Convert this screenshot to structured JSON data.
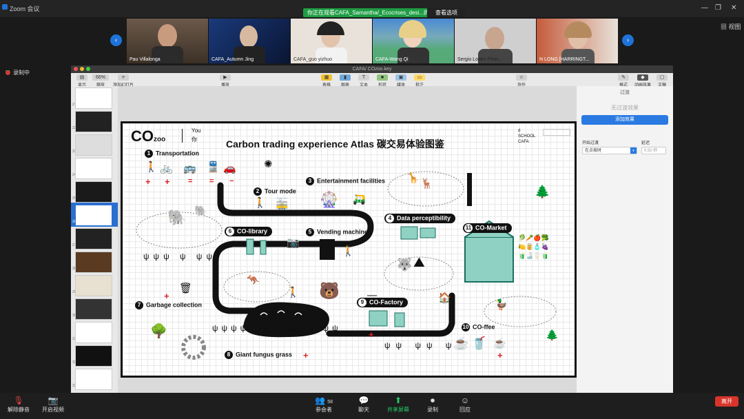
{
  "zoom": {
    "window_title": "Zoom 会议",
    "view_label": "视图",
    "recording_label": "录制中"
  },
  "banner": {
    "text": "你正在观看CAFA_Samantha/_Ecocrises_desi...的屏幕",
    "button": "查看选项"
  },
  "participants": [
    {
      "name": "Pau Villalonga"
    },
    {
      "name": "CAFA_Autumn Jing"
    },
    {
      "name": "CAFA_guo yizhuo"
    },
    {
      "name": "CAFA-Wang Qi"
    },
    {
      "name": "Sergio Lopez-Pinei..."
    },
    {
      "name": "N LONG [HARRINGT..."
    }
  ],
  "keynote": {
    "file_title": "CAFA/ COzoo.key",
    "toolbar": {
      "view": "显示",
      "zoom": "66%",
      "zoom_label": "缩放",
      "add_slide": "添加幻灯片",
      "play": "播放",
      "table": "表格",
      "chart": "图表",
      "text": "文本",
      "shape": "形状",
      "media": "媒体",
      "comment": "批注",
      "collaborate": "协作",
      "format": "格式",
      "animate": "动画效果",
      "document": "文稿"
    },
    "thumb_numbers": [
      "21",
      "22",
      "23",
      "24",
      "25",
      "26",
      "27",
      "28",
      "29",
      "30",
      "31",
      "32",
      "33"
    ],
    "inspector": {
      "tab": "过渡",
      "no_effect": "无过渡效果",
      "add_effect": "添加效果",
      "start_label": "开始过渡",
      "start_value": "在点按时",
      "delay_label": "延迟",
      "delay_value": "0.50 秒"
    }
  },
  "slide": {
    "logo": "CO",
    "logo_sub": "zoo",
    "you": "You",
    "ni": "你",
    "title": "Carbon trading experience Atlas 碳交易体验图鉴",
    "school": [
      "d",
      "SCHOOL",
      "CAFA"
    ],
    "sections": [
      {
        "n": "1",
        "label": "Transportation"
      },
      {
        "n": "2",
        "label": "Tour mode"
      },
      {
        "n": "3",
        "label": "Entertainment facilities"
      },
      {
        "n": "4",
        "label": "Data perceptibility"
      },
      {
        "n": "5",
        "label": "Vending machine"
      },
      {
        "n": "6",
        "label": "CO-library"
      },
      {
        "n": "7",
        "label": "Garbage collection"
      },
      {
        "n": "8",
        "label": "Giant fungus grass"
      },
      {
        "n": "9",
        "label": "CO-Factory"
      },
      {
        "n": "10",
        "label": "CO-ffee"
      },
      {
        "n": "11",
        "label": "CO-Market"
      }
    ]
  },
  "bottom": {
    "mute": "解除静音",
    "video": "开启视频",
    "participants": "参会者",
    "participants_count": "58",
    "chat": "聊天",
    "share": "共享屏幕",
    "record": "录制",
    "reactions": "回应",
    "leave": "离开"
  },
  "colors": {
    "accent_green": "#1f9d44",
    "zoom_blue": "#1e73d8",
    "leave_red": "#d9342b",
    "plus_red": "#d22222"
  }
}
